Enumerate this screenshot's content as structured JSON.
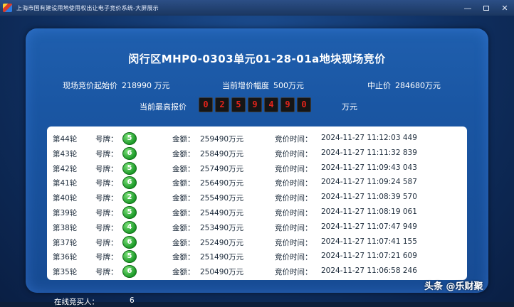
{
  "window": {
    "title": "上海市国有建设用地使用权出让电子竞价系统-大屏展示",
    "minimize_glyph": "—",
    "close_glyph": "✕",
    "app_icon": "app-logo-icon"
  },
  "panel": {
    "title": "闵行区MHP0-0303单元01-28-01a地块现场竞价",
    "start_label": "现场竞价起始价",
    "start_value": "218990 万元",
    "increment_label": "当前增价幅度",
    "increment_value": "500万元",
    "stop_label": "中止价",
    "stop_value": "284680万元",
    "highest_label": "当前最高报价",
    "highest_digits": [
      "0",
      "2",
      "5",
      "9",
      "4",
      "9",
      "0"
    ],
    "highest_unit": "万元"
  },
  "table": {
    "paddle_label": "号牌：",
    "amount_label": "金额：",
    "time_label": "竞价时间：",
    "rows": [
      {
        "round": "第44轮",
        "paddle": "5",
        "amount": "259490万元",
        "time": "2024-11-27 11:12:03 449"
      },
      {
        "round": "第43轮",
        "paddle": "6",
        "amount": "258490万元",
        "time": "2024-11-27 11:11:32 839"
      },
      {
        "round": "第42轮",
        "paddle": "5",
        "amount": "257490万元",
        "time": "2024-11-27 11:09:43 043"
      },
      {
        "round": "第41轮",
        "paddle": "6",
        "amount": "256490万元",
        "time": "2024-11-27 11:09:24 587"
      },
      {
        "round": "第40轮",
        "paddle": "2",
        "amount": "255490万元",
        "time": "2024-11-27 11:08:39 570"
      },
      {
        "round": "第39轮",
        "paddle": "5",
        "amount": "254490万元",
        "time": "2024-11-27 11:08:19 061"
      },
      {
        "round": "第38轮",
        "paddle": "4",
        "amount": "253490万元",
        "time": "2024-11-27 11:07:47 949"
      },
      {
        "round": "第37轮",
        "paddle": "6",
        "amount": "252490万元",
        "time": "2024-11-27 11:07:41 155"
      },
      {
        "round": "第36轮",
        "paddle": "5",
        "amount": "251490万元",
        "time": "2024-11-27 11:07:21 609"
      },
      {
        "round": "第35轮",
        "paddle": "6",
        "amount": "250490万元",
        "time": "2024-11-27 11:06:58 246"
      }
    ]
  },
  "footer": {
    "online_label": "在线竞买人：",
    "online_count": "6"
  },
  "watermark": "头条 @乐财聚",
  "colors": {
    "titlebar": "#1a3660",
    "panel": "#1a56a3",
    "digit_text": "#e4241b",
    "badge": "#1c9a28"
  }
}
